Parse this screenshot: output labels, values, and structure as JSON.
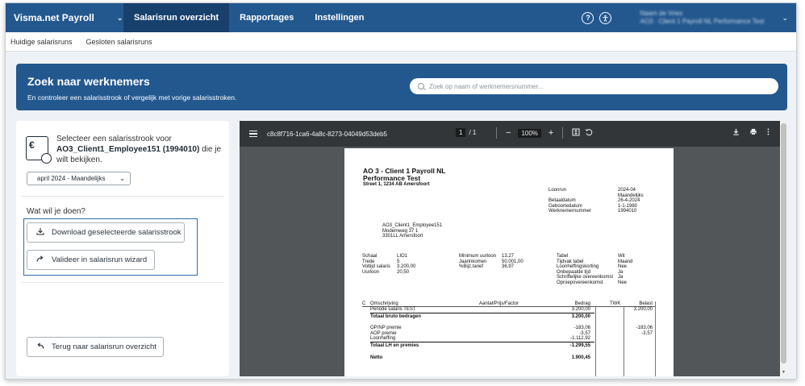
{
  "app": {
    "brand": "Visma.net Payroll",
    "nav_tabs": [
      "Salarisrun overzicht",
      "Rapportages",
      "Instellingen"
    ],
    "help_icon": "?",
    "user": {
      "line1": "Naam de Vries",
      "line2": "AO3 · Client 1 Payroll NL Performance Test"
    }
  },
  "subnav": [
    "Huidige salarisruns",
    "Gesloten salarisruns"
  ],
  "banner": {
    "title": "Zoek naar werknemers",
    "subtitle": "En controleer een salarisstrook of vergelijk met vorige salarisstroken.",
    "search_placeholder": "Zoek op naam of werknemersnummer..."
  },
  "left": {
    "select_prefix": "Selecteer een salarisstrook voor",
    "employee": "AO3_Client1_Employee151 (1994010)",
    "select_suffix": " die je wilt bekijken.",
    "period": "april 2024 - Maandelijks",
    "question": "Wat wil je doen?",
    "download_label": "Download geselecteerde salarisstrook",
    "validate_label": "Valideer in salarisrun wizard",
    "back_label": "Terug naar salarisrun overzicht"
  },
  "viewer": {
    "filename": "c8c8f716-1ca6-4a8c-8273-04049d53deb5",
    "page_current": "1",
    "page_total": "/ 1",
    "zoom": "100%",
    "minus": "−",
    "plus": "+"
  },
  "payslip": {
    "company": "AO 3 - Client 1 Payroll NL",
    "subtitle": "Performance Test",
    "street": "Street 1, 1234 AB Amersfoort",
    "header_labels": [
      "Loonrun",
      "",
      "Betaaldatum",
      "Geboortedatum",
      "Werknemernummer"
    ],
    "header_values": [
      "2024-04",
      "Maandelijks",
      "26-4-2024",
      "1-1-1980",
      "1994010"
    ],
    "address": [
      "AO3_Client1_Employee151",
      "Modemweg 37 1",
      "3301LL Amersfoort"
    ],
    "col1_labels": [
      "Schaal",
      "Trede",
      "Voltijd salaris",
      "Uurloon"
    ],
    "col1_values": [
      "LIO1",
      "5",
      "3.200,00",
      "20,50"
    ],
    "col2_labels": [
      "Minimum uurloon",
      "Jaarinkomen",
      "%Bijz.tarief"
    ],
    "col2_values": [
      "13,27",
      "50.001,00",
      "36,97"
    ],
    "col3_labels": [
      "Tabel",
      "Tijdvak tabel",
      "Loonheffingskorting",
      "Onbepaalde tijd",
      "Schriftelijke overeenkomst",
      "Oproepovereenkomst"
    ],
    "col3_values": [
      "Wit",
      "Maand",
      "Nee",
      "Ja",
      "Ja",
      "Nee"
    ],
    "table_headers": {
      "c": "C",
      "desc": "Omschrijving",
      "qty": "Aantal/Prijs/Factor",
      "amount": "Bedrag",
      "twk": "TWK",
      "taxed": "Belast"
    },
    "rows": {
      "r1_desc": "Periode salaris TEST",
      "r1_amount": "3.200,00",
      "r1_taxed": "3.200,00",
      "r2_desc": "Totaal bruto bedragen",
      "r2_amount": "3.200,00",
      "r3_desc": "OP/NP premie",
      "r3_amount": "-183,06",
      "r3_taxed": "-183,06",
      "r4_desc": "AOP premie",
      "r4_amount": "-3,57",
      "r4_taxed": "-3,57",
      "r5_desc": "Loonheffing",
      "r5_amount": "-1.112,92",
      "r6_desc": "Totaal LH en premies",
      "r6_amount": "-1.299,55",
      "r7_desc": "Netto",
      "r7_amount": "1.900,45"
    }
  }
}
